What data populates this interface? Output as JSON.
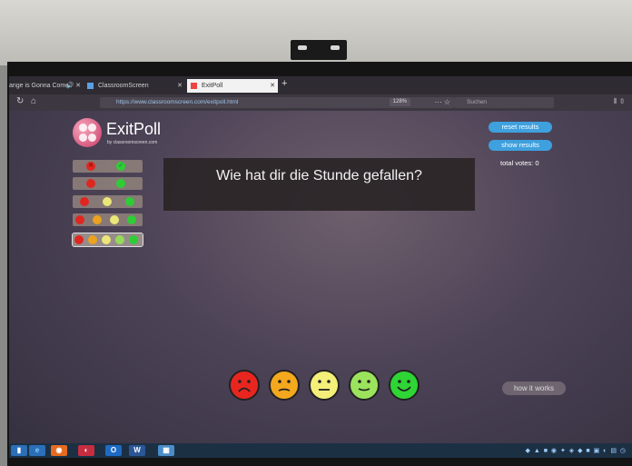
{
  "browser": {
    "tabs": [
      {
        "label": "ange is Gonna Come",
        "active": false
      },
      {
        "label": "ClassroomScreen",
        "active": false
      },
      {
        "label": "ExitPoll",
        "active": true
      }
    ],
    "url": "https://www.classroomscreen.com/exitpoll.html",
    "zoom": "128%",
    "search_placeholder": "Suchen"
  },
  "app": {
    "title": "ExitPoll",
    "subtitle": "by classroomscreen.com",
    "question": "Wie hat dir die Stunde gefallen?",
    "reset_label": "reset results",
    "show_label": "show results",
    "total_votes": "total votes: 0",
    "how_it_works": "how it works"
  },
  "options": [
    {
      "faces": [
        "sad",
        "check"
      ]
    },
    {
      "faces": [
        "sad",
        "happy"
      ]
    },
    {
      "faces": [
        "sad",
        "neutral",
        "happy"
      ]
    },
    {
      "faces": [
        "sad",
        "meh",
        "neutral",
        "smile",
        "happy"
      ],
      "note": "4 faces shown"
    },
    {
      "faces": [
        "sad",
        "meh",
        "neutral",
        "smile",
        "happy"
      ],
      "selected": true
    }
  ],
  "faces": [
    {
      "name": "very-sad-face-button",
      "color": "#e8261f",
      "mouth": "frown"
    },
    {
      "name": "sad-face-button",
      "color": "#f4a81d",
      "mouth": "slight-frown"
    },
    {
      "name": "neutral-face-button",
      "color": "#f3ef79",
      "mouth": "flat"
    },
    {
      "name": "smile-face-button",
      "color": "#9be35c",
      "mouth": "smile"
    },
    {
      "name": "happy-face-button",
      "color": "#2ed534",
      "mouth": "big-smile"
    }
  ]
}
